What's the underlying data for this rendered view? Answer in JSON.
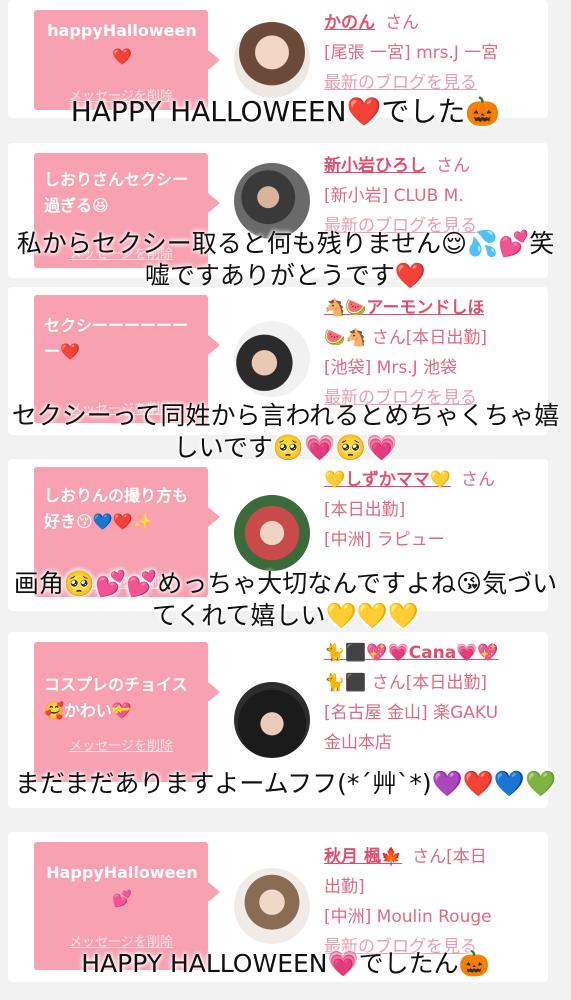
{
  "cards": [
    {
      "message": "happyHalloween❤️",
      "delete_label": "メッセージを削除",
      "name": "かのん",
      "san": "さん",
      "line2": "[尾張 一宮] mrs.J 一宮",
      "blog_label": "最新のブログを見る"
    },
    {
      "message": "しおりさんセクシー過ぎる😆",
      "delete_label": "メッセージを削除",
      "name": "新小岩ひろし",
      "san": "さん",
      "line2": "[新小岩] CLUB M.",
      "blog_label": "最新のブログを見る"
    },
    {
      "message": "セクシーーーーーーー❤️",
      "delete_label": "メッセージを削除",
      "name": "🐴🍉アーモンドしほ",
      "san": "🍉🐴 さん[本日出勤]",
      "line2": "[池袋] Mrs.J 池袋",
      "blog_label": "最新のブログを見る"
    },
    {
      "message": "しおりんの撮り方も好き😚💙❤️✨",
      "delete_label": "メッセージを削除",
      "name": "💛しずかママ💛",
      "san": "さん",
      "line2": "[本日出勤]",
      "line3": "[中洲] ラピュー"
    },
    {
      "message": "コスプレのチョイス🥰かわい💝",
      "delete_label": "メッセージを削除",
      "name": "🐈⬛💖💗Cana💗💖",
      "san": "🐈⬛ さん[本日出勤]",
      "line2": "[名古屋 金山] 楽GAKU",
      "line3": "金山本店"
    },
    {
      "message": "HappyHalloween💕",
      "delete_label": "メッセージを削除",
      "name": "秋月 楓🍁",
      "san": "さん[本日",
      "line2": "出勤]",
      "line3": "[中洲] Moulin Rouge",
      "blog_label": "最新のブログを見る"
    }
  ],
  "overlays": [
    "HAPPY HALLOWEEN❤️でした🎃",
    "私からセクシー取ると何も残りません😌💦💕笑 嘘ですありがとうです❤️",
    "セクシーって同姓から言われるとめちゃくちゃ嬉しいです🥺💗🥺💗",
    "画角🥺💕💕めっちゃ大切なんですよね😘気づいてくれて嬉しい💛💛💛",
    "まだまだありますよームフフ(*´艸`*)💜❤️💙💚",
    "HAPPY HALLOWEEN💗でしたん🎃"
  ],
  "colors": {
    "bubble": "#f7a1b1",
    "name": "#e0506e",
    "text": "#e06a80"
  }
}
